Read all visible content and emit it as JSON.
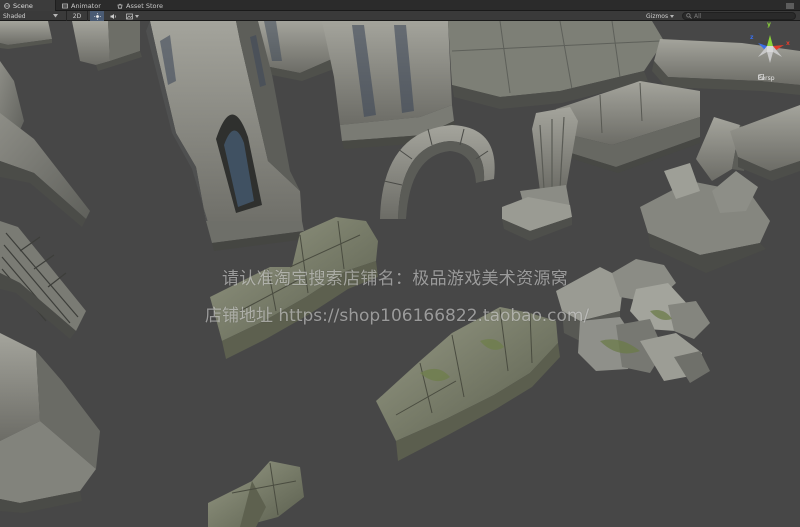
{
  "tabs": [
    {
      "label": "Scene",
      "icon": "scene-icon",
      "active": true
    },
    {
      "label": "Animator",
      "icon": "animator-icon",
      "active": false
    },
    {
      "label": "Asset Store",
      "icon": "store-icon",
      "active": false
    }
  ],
  "toolbar": {
    "shading_mode": "Shaded",
    "mode_2d": "2D",
    "gizmos_label": "Gizmos",
    "search_placeholder": "All"
  },
  "viewport": {
    "projection_label": "Persp",
    "axes": {
      "y": "y",
      "x": "x",
      "z": "z"
    }
  },
  "watermark": {
    "line1": "请认准淘宝搜索店铺名：极品游戏美术资源窝",
    "line2": "店铺地址 https://shop106166822.taobao.com/"
  },
  "colors": {
    "background": "#474747",
    "axis_x": "#e03c2c",
    "axis_y": "#8bd43a",
    "axis_z": "#3a6ee8"
  }
}
